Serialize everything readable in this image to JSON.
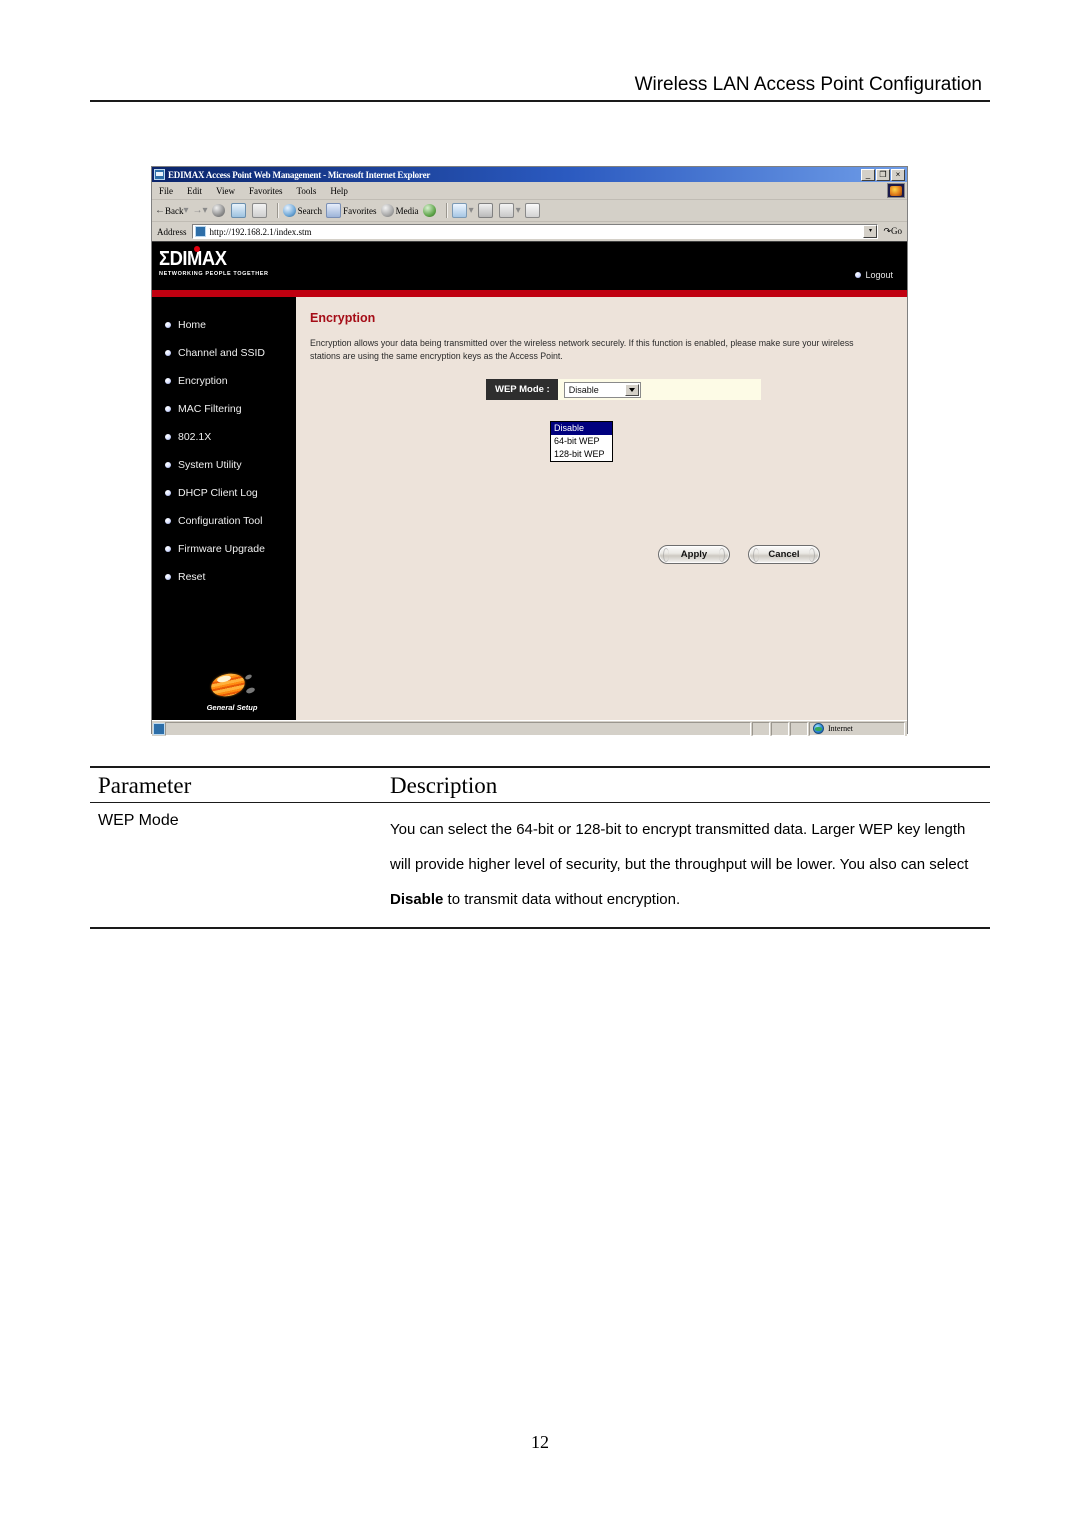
{
  "document": {
    "header_title": "Wireless LAN Access Point Configuration",
    "page_number": "12"
  },
  "browser": {
    "window_title": "EDIMAX Access Point Web Management - Microsoft Internet Explorer",
    "title_icon": "ie-document-icon",
    "window_controls": {
      "minimize": "_",
      "restore": "❐",
      "close": "×"
    },
    "menu": [
      {
        "label": "File"
      },
      {
        "label": "Edit"
      },
      {
        "label": "View"
      },
      {
        "label": "Favorites"
      },
      {
        "label": "Tools"
      },
      {
        "label": "Help"
      }
    ],
    "toolbar": [
      {
        "label": "Back",
        "icon": "back-arrow-icon"
      },
      {
        "label": "",
        "icon": "forward-arrow-icon"
      },
      {
        "label": "",
        "icon": "stop-icon"
      },
      {
        "label": "",
        "icon": "refresh-icon"
      },
      {
        "label": "",
        "icon": "home-icon"
      },
      {
        "label": "Search",
        "icon": "search-icon"
      },
      {
        "label": "Favorites",
        "icon": "favorites-star-icon"
      },
      {
        "label": "Media",
        "icon": "media-icon"
      },
      {
        "label": "",
        "icon": "history-icon"
      },
      {
        "label": "",
        "icon": "mail-icon"
      },
      {
        "label": "",
        "icon": "print-icon"
      },
      {
        "label": "",
        "icon": "edit-icon"
      },
      {
        "label": "",
        "icon": "discuss-icon"
      }
    ],
    "address": {
      "label": "Address",
      "url": "http://192.168.2.1/index.stm",
      "go_label": "Go",
      "icon": "page-icon"
    },
    "statusbar": {
      "message": "",
      "zone": "Internet",
      "zone_icon": "globe-icon"
    }
  },
  "webpage": {
    "brand": {
      "logo_text": "ΣDIMAX",
      "tagline": "NETWORKING PEOPLE TOGETHER",
      "logout_label": "Logout"
    },
    "sidebar": {
      "items": [
        {
          "label": "Home"
        },
        {
          "label": "Channel and SSID"
        },
        {
          "label": "Encryption"
        },
        {
          "label": "MAC Filtering"
        },
        {
          "label": "802.1X"
        },
        {
          "label": "System Utility"
        },
        {
          "label": "DHCP Client Log"
        },
        {
          "label": "Configuration Tool"
        },
        {
          "label": "Firmware Upgrade"
        },
        {
          "label": "Reset"
        }
      ],
      "footer_label": "General Setup",
      "footer_icon": "general-setup-icon"
    },
    "main": {
      "title": "Encryption",
      "description": "Encryption allows your data being transmitted over the wireless network securely. If this function is enabled, please make sure your wireless stations are using the same encryption keys as the Access Point.",
      "form": {
        "wep_mode_label": "WEP Mode :",
        "wep_mode_value": "Disable",
        "wep_mode_options": [
          {
            "label": "Disable",
            "selected": true
          },
          {
            "label": "64-bit WEP",
            "selected": false
          },
          {
            "label": "128-bit WEP",
            "selected": false
          }
        ]
      },
      "buttons": {
        "apply": "Apply",
        "cancel": "Cancel"
      }
    }
  },
  "param_table": {
    "headers": {
      "parameter": "Parameter",
      "description": "Description"
    },
    "rows": [
      {
        "parameter": "WEP Mode",
        "description_part1": "You can select the 64-bit or 128-bit to encrypt transmitted data. Larger WEP key length will provide higher level of security, but the throughput will be lower. You also can select ",
        "description_bold": "Disable",
        "description_part2": " to transmit data without encryption."
      }
    ]
  },
  "colors": {
    "brand_red": "#c00010",
    "title_red": "#a50d17",
    "content_bg": "#ede3da",
    "field_bg": "#fdfbe6",
    "select_highlight": "#00007e",
    "chrome_gray": "#d4d0c8"
  }
}
